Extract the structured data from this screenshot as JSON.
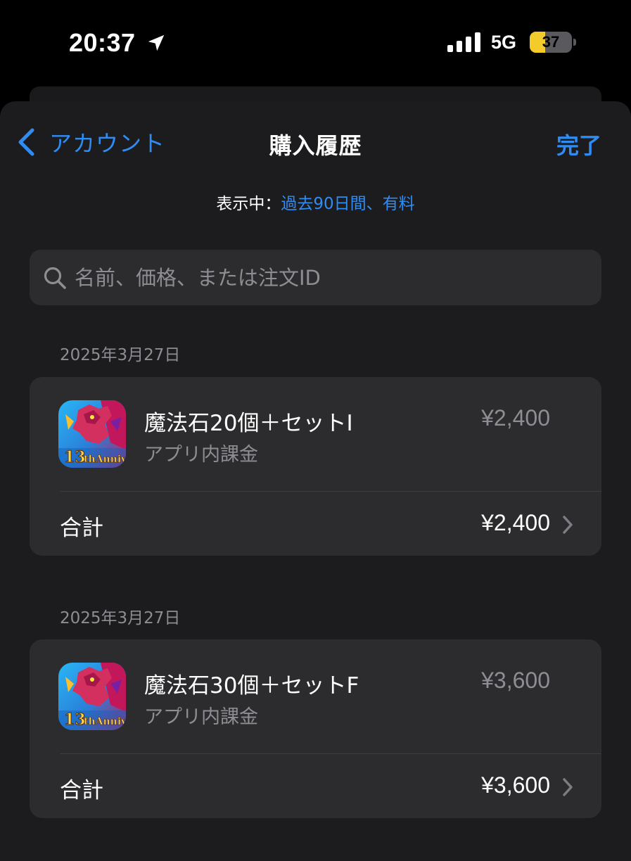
{
  "status_bar": {
    "time": "20:37",
    "network": "5G",
    "battery": "37",
    "battery_level": 0.37
  },
  "nav": {
    "back_label": "アカウント",
    "title": "購入履歴",
    "done_label": "完了"
  },
  "filter": {
    "prefix": "表示中：",
    "value": "過去90日間、有料"
  },
  "search": {
    "placeholder": "名前、価格、または注文ID",
    "value": ""
  },
  "purchases": [
    {
      "date": "2025年3月27日",
      "item_name": "魔法石20個＋セットI",
      "item_type": "アプリ内課金",
      "item_price": "¥2,400",
      "total_label": "合計",
      "total_price": "¥2,400"
    },
    {
      "date": "2025年3月27日",
      "item_name": "魔法石30個＋セットF",
      "item_type": "アプリ内課金",
      "item_price": "¥3,600",
      "total_label": "合計",
      "total_price": "¥3,600"
    }
  ],
  "colors": {
    "accent": "#2f8cf2",
    "background": "#000000",
    "sheet": "#1c1c1e",
    "card": "#2c2c2e",
    "secondary_text": "#8d8d93",
    "battery_yellow": "#f3cc2c"
  },
  "icons": {
    "location": "location-arrow-icon",
    "signal": "cellular-signal-icon",
    "back": "chevron-left-icon",
    "search": "magnifying-glass-icon",
    "disclosure": "chevron-right-icon",
    "app": "app-icon"
  }
}
